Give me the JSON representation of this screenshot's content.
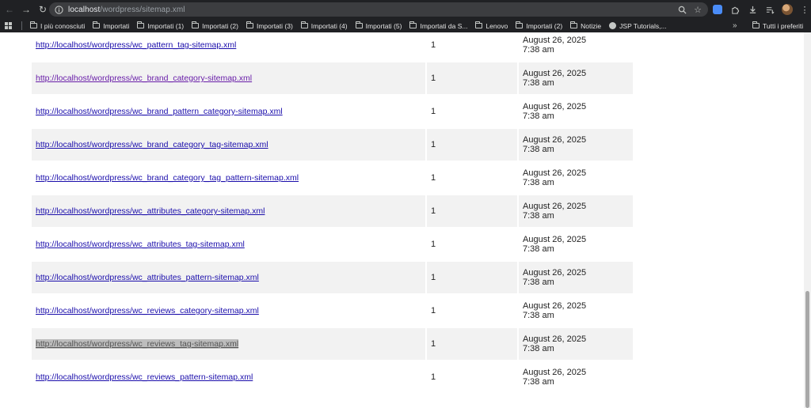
{
  "browser": {
    "url_host": "localhost",
    "url_path": "/wordpress/sitemap.xml"
  },
  "bookmarks": [
    {
      "label": "I più conosciuti",
      "type": "folder"
    },
    {
      "label": "Importati",
      "type": "folder"
    },
    {
      "label": "Importati (1)",
      "type": "folder"
    },
    {
      "label": "Importati (2)",
      "type": "folder"
    },
    {
      "label": "Importati (3)",
      "type": "folder"
    },
    {
      "label": "Importati (4)",
      "type": "folder"
    },
    {
      "label": "Importati (5)",
      "type": "folder"
    },
    {
      "label": "Importati da S...",
      "type": "folder"
    },
    {
      "label": "Lenovo",
      "type": "folder"
    },
    {
      "label": "Importati (2)",
      "type": "folder"
    },
    {
      "label": "Notizie",
      "type": "folder"
    },
    {
      "label": "JSP Tutorials,...",
      "type": "site"
    }
  ],
  "bookmarks_more": "»",
  "bookmarks_all": "Tutti i preferiti",
  "rows": [
    {
      "url": "http://localhost/wordpress/wc_pattern_tag-sitemap.xml",
      "count": "1",
      "date": "August 26, 2025",
      "time": "7:38 am",
      "state": "normal"
    },
    {
      "url": "http://localhost/wordpress/wc_brand_category-sitemap.xml",
      "count": "1",
      "date": "August 26, 2025",
      "time": "7:38 am",
      "state": "visited"
    },
    {
      "url": "http://localhost/wordpress/wc_brand_pattern_category-sitemap.xml",
      "count": "1",
      "date": "August 26, 2025",
      "time": "7:38 am",
      "state": "normal"
    },
    {
      "url": "http://localhost/wordpress/wc_brand_category_tag-sitemap.xml",
      "count": "1",
      "date": "August 26, 2025",
      "time": "7:38 am",
      "state": "normal"
    },
    {
      "url": "http://localhost/wordpress/wc_brand_category_tag_pattern-sitemap.xml",
      "count": "1",
      "date": "August 26, 2025",
      "time": "7:38 am",
      "state": "normal"
    },
    {
      "url": "http://localhost/wordpress/wc_attributes_category-sitemap.xml",
      "count": "1",
      "date": "August 26, 2025",
      "time": "7:38 am",
      "state": "normal"
    },
    {
      "url": "http://localhost/wordpress/wc_attributes_tag-sitemap.xml",
      "count": "1",
      "date": "August 26, 2025",
      "time": "7:38 am",
      "state": "normal"
    },
    {
      "url": "http://localhost/wordpress/wc_attributes_pattern-sitemap.xml",
      "count": "1",
      "date": "August 26, 2025",
      "time": "7:38 am",
      "state": "normal"
    },
    {
      "url": "http://localhost/wordpress/wc_reviews_category-sitemap.xml",
      "count": "1",
      "date": "August 26, 2025",
      "time": "7:38 am",
      "state": "normal"
    },
    {
      "url": "http://localhost/wordpress/wc_reviews_tag-sitemap.xml",
      "count": "1",
      "date": "August 26, 2025",
      "time": "7:38 am",
      "state": "highlighted"
    },
    {
      "url": "http://localhost/wordpress/wc_reviews_pattern-sitemap.xml",
      "count": "1",
      "date": "August 26, 2025",
      "time": "7:38 am",
      "state": "normal"
    }
  ]
}
